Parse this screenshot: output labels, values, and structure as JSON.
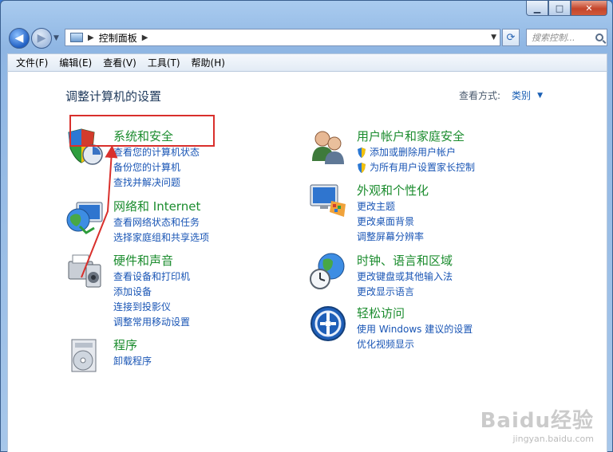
{
  "window": {
    "min_label": "▁",
    "max_label": "□",
    "close_label": "✕"
  },
  "address": {
    "path": "控制面板",
    "search_placeholder": "搜索控制..."
  },
  "menu": [
    {
      "label": "文件(F)"
    },
    {
      "label": "编辑(E)"
    },
    {
      "label": "查看(V)"
    },
    {
      "label": "工具(T)"
    },
    {
      "label": "帮助(H)"
    }
  ],
  "main": {
    "title": "调整计算机的设置",
    "view_by_label": "查看方式:",
    "view_by_value": "类别"
  },
  "categories": {
    "system": {
      "title": "系统和安全",
      "links": [
        "查看您的计算机状态",
        "备份您的计算机",
        "查找并解决问题"
      ]
    },
    "network": {
      "title": "网络和 Internet",
      "links": [
        "查看网络状态和任务",
        "选择家庭组和共享选项"
      ]
    },
    "hardware": {
      "title": "硬件和声音",
      "links": [
        "查看设备和打印机",
        "添加设备",
        "连接到投影仪",
        "调整常用移动设置"
      ]
    },
    "programs": {
      "title": "程序",
      "links": [
        "卸载程序"
      ]
    },
    "users": {
      "title": "用户帐户和家庭安全",
      "links": [
        "添加或删除用户帐户",
        "为所有用户设置家长控制"
      ]
    },
    "appearance": {
      "title": "外观和个性化",
      "links": [
        "更改主题",
        "更改桌面背景",
        "调整屏幕分辨率"
      ]
    },
    "clock": {
      "title": "时钟、语言和区域",
      "links": [
        "更改键盘或其他输入法",
        "更改显示语言"
      ]
    },
    "ease": {
      "title": "轻松访问",
      "links": [
        "使用 Windows 建议的设置",
        "优化视频显示"
      ]
    }
  },
  "watermark": {
    "main": "Baidu经验",
    "sub": "jingyan.baidu.com"
  },
  "colors": {
    "title_green": "#1b8c2e",
    "link_blue": "#1955b5",
    "highlight_red": "#d9302c"
  }
}
